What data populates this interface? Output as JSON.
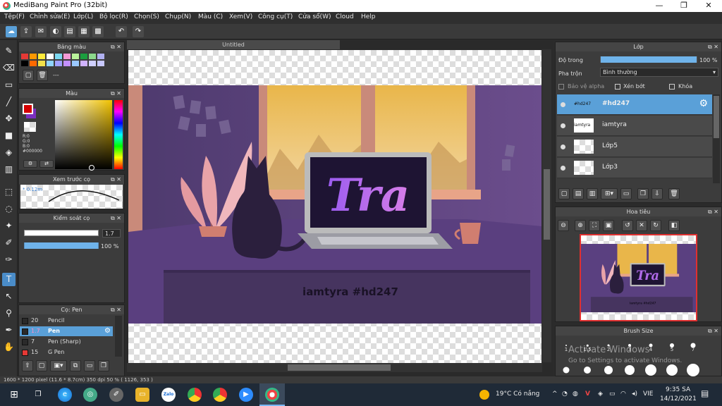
{
  "window": {
    "title": "MediBang Paint Pro (32bit)",
    "buttons": {
      "minimize": "—",
      "maximize": "❐",
      "close": "✕"
    }
  },
  "menu": [
    "Tệp(F)",
    "Chỉnh sửa(E)",
    "Lớp(L)",
    "Bộ lọc(R)",
    "Chọn(S)",
    "Chụp(N)",
    "Màu (C)",
    "Xem(V)",
    "Công cụ(T)",
    "Cửa sổ(W)",
    "Cloud",
    "Help"
  ],
  "palette_panel": {
    "title": "Bảng màu",
    "value": "---"
  },
  "color_panel": {
    "title": "Màu",
    "r": "R:0",
    "g": "G:0",
    "b": "B:0",
    "hex": "#000000",
    "primary": "#d40000",
    "secondary": "#7b2fbf"
  },
  "preview_panel": {
    "title": "Xem trước cọ",
    "size": "* 0.12m"
  },
  "brush_control": {
    "title": "Kiểm soát cọ",
    "size": "1.7",
    "opacity": "100 %",
    "opacity_value": 100
  },
  "brush_panel": {
    "title": "Cọ: Pen",
    "items": [
      {
        "size": "20",
        "name": "Pencil",
        "color": "#2a2a2a"
      },
      {
        "size": "1.7",
        "name": "Pen",
        "color": "#2a2a2a"
      },
      {
        "size": "7",
        "name": "Pen (Sharp)",
        "color": "#2a2a2a"
      },
      {
        "size": "15",
        "name": "G Pen",
        "color": "#e53935"
      }
    ]
  },
  "canvas": {
    "tab": "Untitled",
    "laptop_text": "Tra",
    "caption": "iamtyra  #hd247"
  },
  "layer_panel": {
    "title": "Lớp",
    "opacity_label": "Độ trong",
    "opacity_value": "100 %",
    "opacity": 100,
    "blend_label": "Pha trộn",
    "blend_value": "Bình thường",
    "protect_alpha": "Bảo vệ alpha",
    "clip": "Xén bớt",
    "lock": "Khóa",
    "layers": [
      {
        "name": "#hd247",
        "thumb": "#hd247"
      },
      {
        "name": "iamtyra",
        "thumb": "iamtyra"
      },
      {
        "name": "Lớp5",
        "thumb": ""
      },
      {
        "name": "Lớp3",
        "thumb": ""
      }
    ]
  },
  "navigator_panel": {
    "title": "Hoa tiêu",
    "mini_text": "Tra",
    "mini_caption": "iamtyra  #hd247"
  },
  "brush_size_panel": {
    "title": "Brush Size",
    "sizes": [
      "1",
      "1.5",
      "2",
      "3",
      "4",
      "5",
      "7"
    ],
    "watermark_1": "Activate Windows",
    "watermark_2": "Go to Settings to activate Windows."
  },
  "status": {
    "text": "1600 * 1200 pixel   (11.6 * 8.7cm)   350 dpi   50 %   ( 1126, 353 )"
  },
  "taskbar": {
    "weather": "19°C  Có nắng",
    "lang": "VIE",
    "time": "9:35 SA",
    "date": "14/12/2021",
    "zalo": "Zalo"
  }
}
